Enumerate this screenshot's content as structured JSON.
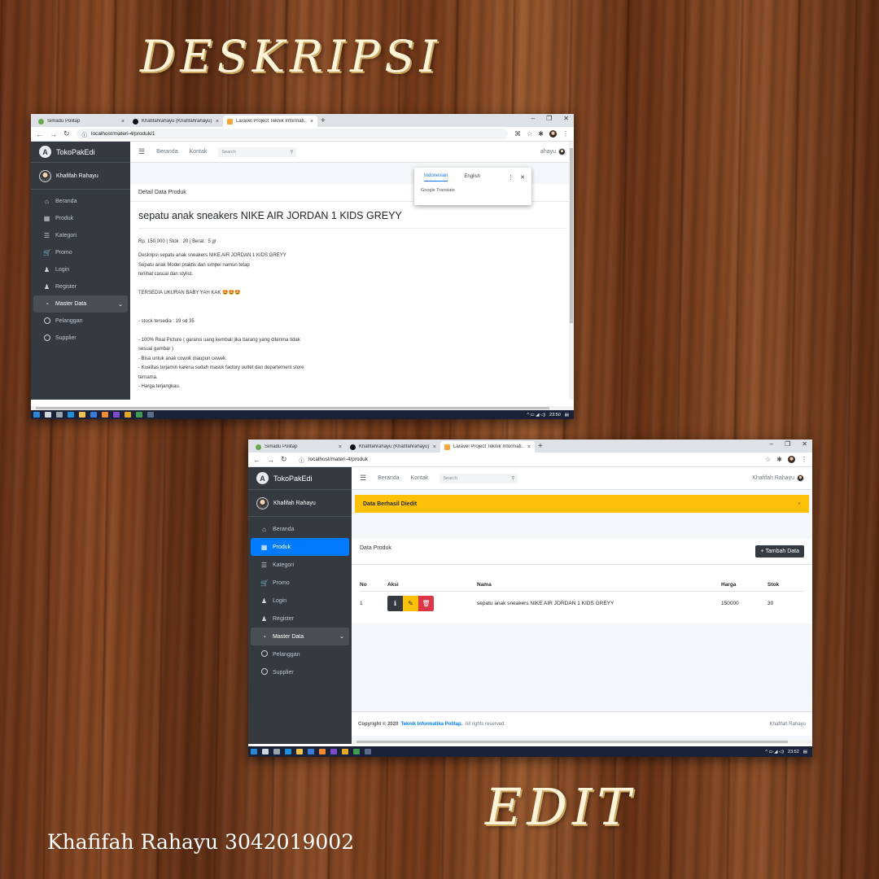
{
  "captions": {
    "top": "DESKRIPSI",
    "bottom": "EDIT",
    "author": "Khafifah Rahayu  3042019002"
  },
  "browser": {
    "tabs": [
      "Simadu Politap",
      "Khafifahrahayu (Khafifahrahayu)",
      "Laravel Project Teknik Informati..."
    ],
    "tab_close": "×",
    "new_tab": "+",
    "win_controls": [
      "–",
      "❐",
      "✕"
    ]
  },
  "app": {
    "brand": "TokoPakEdi",
    "brand_logo": "A",
    "user": "Khafifah Rahayu",
    "nav": [
      {
        "icon": "home-icon",
        "label": "Beranda"
      },
      {
        "icon": "grid-icon",
        "label": "Produk"
      },
      {
        "icon": "list-icon",
        "label": "Kategori"
      },
      {
        "icon": "cart-icon",
        "label": "Promo"
      },
      {
        "icon": "user-icon",
        "label": "Login"
      },
      {
        "icon": "user-icon",
        "label": "Register"
      },
      {
        "icon": "dashboard-icon",
        "label": "Master Data"
      },
      {
        "icon": "circle-icon",
        "label": "Pelanggan"
      },
      {
        "icon": "circle-icon",
        "label": "Supplier"
      }
    ],
    "topnav": {
      "home": "Beranda",
      "contact": "Kontak",
      "search_placeholder": "Search"
    },
    "accent": "#007bff"
  },
  "screen_detail": {
    "url": "localhost/materi-4/produk/1",
    "user_partial": "ahayu",
    "translate": {
      "lang1": "Indonesian",
      "lang2": "English",
      "brand": "Google Translate",
      "more": "⋮",
      "close": "✕"
    },
    "header": "Detail Data Produk",
    "title": "sepatu anak sneakers NIKE AIR JORDAN 1 KIDS GREYY",
    "meta": "Rp. 150,000 | Stok : 20 | Berat : 5 gr",
    "description": "Deskripsi sepatu anak sneakers NIKE AIR JORDAN 1 KIDS GREYY\nSepatu anak Model praktis dan simpel namun tetap\nterlihat casual dan stylist.\n\nTERSEDIA UKURAN BABY YAH KAK 🤩🤩🤩\n\n\n- stock tersedia : 19 sd 35\n\n- 100% Real Picture ( garansi uang kembali jika barang yang diterima tidak\nsesuai gambar )\n- Bisa untuk anak cowok maupun cewek\n- Kualitas terjamin karena sudah masuk factory outlet dan departement store\nternama.\n- Harga terjangkau.",
    "clock": "23:50"
  },
  "screen_edit": {
    "url": "localhost/materi-4/produk",
    "user": "Khafifah Rahayu",
    "alert": "Data Berhasil Diedit",
    "alert_close": "×",
    "card_title": "Data Produk",
    "add_button": "+ Tambah Data",
    "columns": [
      "No",
      "Aksi",
      "Nama",
      "Harga",
      "Stok"
    ],
    "rows": [
      {
        "no": "1",
        "nama": "sepatu anak sneakers NIKE AIR JORDAN 1 KIDS GREYY",
        "harga": "150000",
        "stok": "30"
      }
    ],
    "footer_prefix": "Copyright © 2020",
    "footer_link": "Teknik Informatika Politap.",
    "footer_suffix": "All rights reserved.",
    "footer_right": "Khafifah Rahayu",
    "clock": "23:52"
  }
}
